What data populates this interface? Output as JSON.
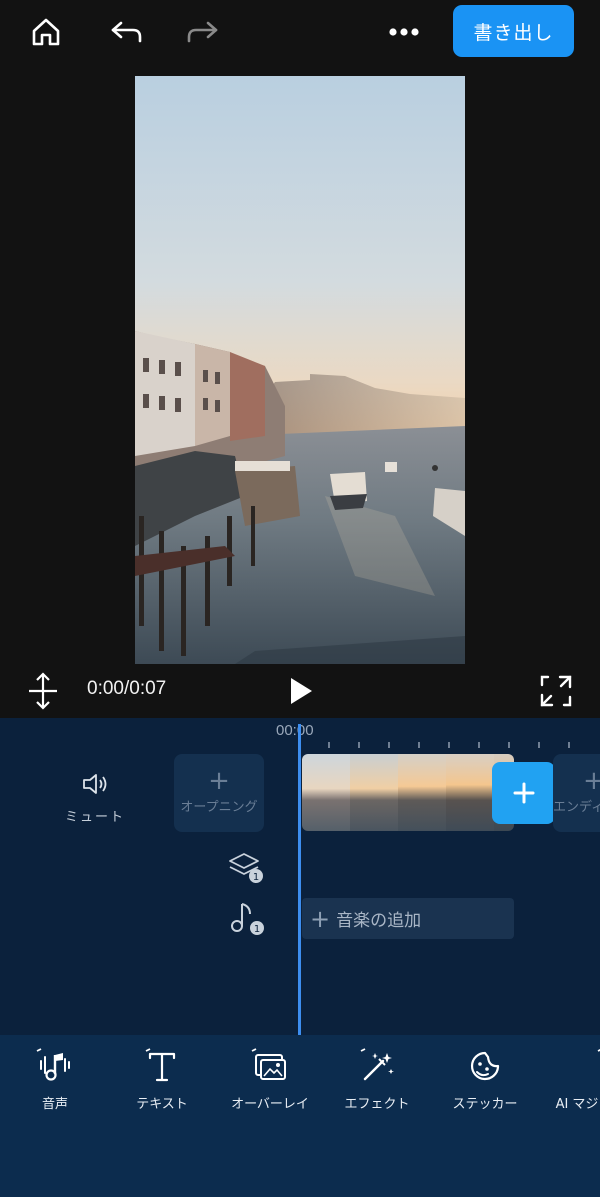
{
  "topbar": {
    "home_icon": "home-icon",
    "undo_icon": "undo-icon",
    "redo_icon": "redo-icon",
    "more_icon": "more-icon",
    "export_label": "書き出し",
    "accent": "#1a93f4"
  },
  "playback": {
    "time": "0:00/0:07",
    "split_icon": "split-vertical-icon",
    "play_icon": "play-icon",
    "fullscreen_icon": "fullscreen-icon"
  },
  "timeline": {
    "timestamp": "00:00",
    "mute_label": "ミュート",
    "opening_label": "オープニング",
    "ending_label": "エンディング",
    "overlay_track_count": "1",
    "audio_track_count": "1",
    "add_music_label": "音楽の追加",
    "playhead_color": "#3d8ef0"
  },
  "toolbar": {
    "items": [
      {
        "label": "音声",
        "icon": "audio-icon"
      },
      {
        "label": "テキスト",
        "icon": "text-icon"
      },
      {
        "label": "オーバーレイ",
        "icon": "overlay-icon"
      },
      {
        "label": "エフェクト",
        "icon": "effect-wand-icon"
      },
      {
        "label": "ステッカー",
        "icon": "sticker-icon"
      },
      {
        "label": "AI マジック",
        "icon": "ai-icon"
      }
    ]
  }
}
